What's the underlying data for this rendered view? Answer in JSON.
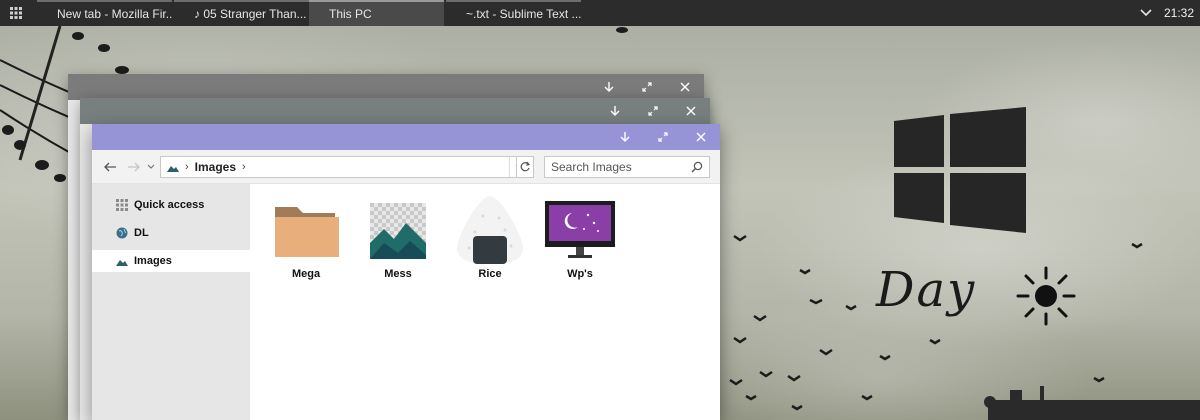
{
  "taskbar": {
    "tasks": [
      {
        "label": "New tab - Mozilla Fir..."
      },
      {
        "label": "♪ 05 Stranger Than..."
      },
      {
        "label": "This PC"
      },
      {
        "label": "~.txt - Sublime Text ..."
      }
    ],
    "active_task_index": 2,
    "clock": "21:32"
  },
  "explorer": {
    "title_color": "#9693d6",
    "address": {
      "crumbs": [
        "Images"
      ]
    },
    "search": {
      "placeholder": "Search Images"
    },
    "sidebar": [
      {
        "label": "Quick access",
        "icon": "grid-icon"
      },
      {
        "label": "DL",
        "icon": "globe-icon"
      },
      {
        "label": "Images",
        "icon": "mountain-icon",
        "selected": true
      }
    ],
    "folders": [
      {
        "label": "Mega",
        "icon": "folder-icon"
      },
      {
        "label": "Mess",
        "icon": "mountain-image-icon"
      },
      {
        "label": "Rice",
        "icon": "onigiri-icon"
      },
      {
        "label": "Wp's",
        "icon": "monitor-moon-icon"
      }
    ]
  },
  "desktop": {
    "widget_text": "Day",
    "widget_icon": "sun-icon"
  }
}
